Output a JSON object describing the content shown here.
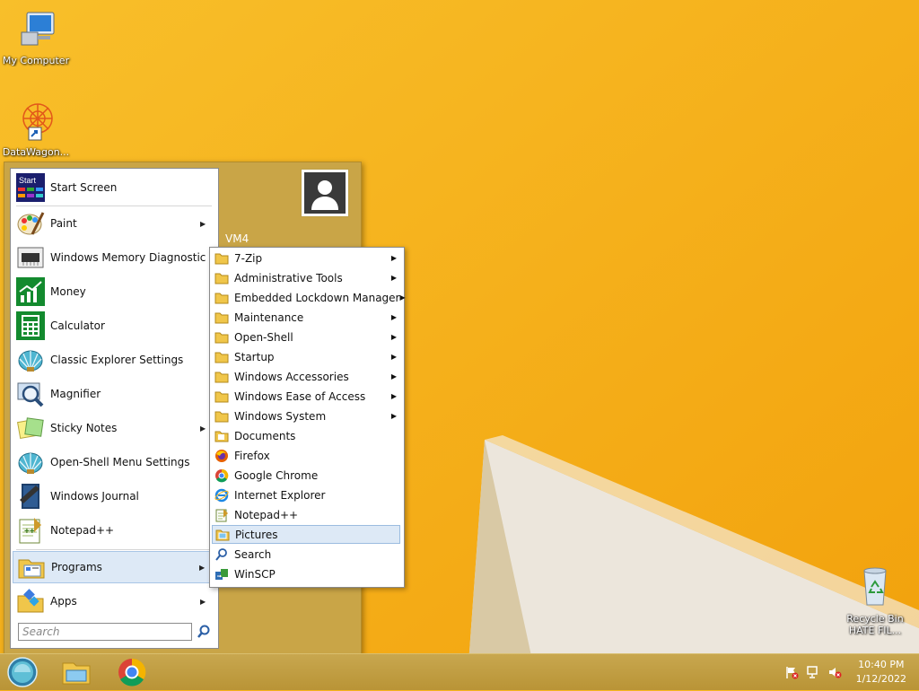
{
  "desktop": {
    "icons": [
      {
        "label": "My Computer",
        "icon": "computer-icon"
      },
      {
        "label": "DataWagon...",
        "icon": "datawagon-shortcut-icon"
      },
      {
        "label": "Recycle Bin\nHATE FIL...",
        "line1": "Recycle Bin",
        "line2": "HATE FIL...",
        "icon": "recycle-bin-icon"
      }
    ]
  },
  "start_menu": {
    "user_name": "VM4",
    "items": [
      {
        "label": "Start Screen",
        "icon": "start-screen-icon",
        "has_submenu": false
      },
      {
        "label": "Paint",
        "icon": "paint-icon",
        "has_submenu": true
      },
      {
        "label": "Windows Memory Diagnostic",
        "icon": "memory-chip-icon",
        "has_submenu": false
      },
      {
        "label": "Money",
        "icon": "money-chart-icon",
        "has_submenu": false
      },
      {
        "label": "Calculator",
        "icon": "calculator-icon",
        "has_submenu": false
      },
      {
        "label": "Classic Explorer Settings",
        "icon": "shell-icon",
        "has_submenu": false
      },
      {
        "label": "Magnifier",
        "icon": "magnifier-icon",
        "has_submenu": false
      },
      {
        "label": "Sticky Notes",
        "icon": "sticky-notes-icon",
        "has_submenu": true
      },
      {
        "label": "Open-Shell Menu Settings",
        "icon": "shell-icon",
        "has_submenu": false
      },
      {
        "label": "Windows Journal",
        "icon": "journal-icon",
        "has_submenu": false
      },
      {
        "label": "Notepad++",
        "icon": "notepad-plus-icon",
        "has_submenu": false
      },
      {
        "label": "Programs",
        "icon": "programs-icon",
        "has_submenu": true,
        "selected": true
      },
      {
        "label": "Apps",
        "icon": "apps-icon",
        "has_submenu": true
      }
    ],
    "search_placeholder": "Search"
  },
  "programs_submenu": {
    "items": [
      {
        "label": "7-Zip",
        "icon": "folder-icon",
        "has_submenu": true
      },
      {
        "label": "Administrative Tools",
        "icon": "folder-icon",
        "has_submenu": true
      },
      {
        "label": "Embedded Lockdown Manager",
        "icon": "folder-icon",
        "has_submenu": true
      },
      {
        "label": "Maintenance",
        "icon": "folder-icon",
        "has_submenu": true
      },
      {
        "label": "Open-Shell",
        "icon": "folder-icon",
        "has_submenu": true
      },
      {
        "label": "Startup",
        "icon": "folder-icon",
        "has_submenu": true
      },
      {
        "label": "Windows Accessories",
        "icon": "folder-icon",
        "has_submenu": true
      },
      {
        "label": "Windows Ease of Access",
        "icon": "folder-icon",
        "has_submenu": true
      },
      {
        "label": "Windows System",
        "icon": "folder-icon",
        "has_submenu": true
      },
      {
        "label": "Documents",
        "icon": "documents-icon",
        "has_submenu": false
      },
      {
        "label": "Firefox",
        "icon": "firefox-icon",
        "has_submenu": false
      },
      {
        "label": "Google Chrome",
        "icon": "chrome-icon",
        "has_submenu": false
      },
      {
        "label": "Internet Explorer",
        "icon": "ie-icon",
        "has_submenu": false
      },
      {
        "label": "Notepad++",
        "icon": "notepad-plus-icon",
        "has_submenu": false
      },
      {
        "label": "Pictures",
        "icon": "pictures-icon",
        "has_submenu": false,
        "selected": true
      },
      {
        "label": "Search",
        "icon": "search-icon",
        "has_submenu": false
      },
      {
        "label": "WinSCP",
        "icon": "winscp-icon",
        "has_submenu": false
      }
    ]
  },
  "taskbar": {
    "buttons": [
      {
        "icon": "start-orb-icon"
      },
      {
        "icon": "file-explorer-icon"
      },
      {
        "icon": "chrome-icon"
      }
    ],
    "tray": {
      "icons": [
        "action-center-flag-icon",
        "network-icon",
        "volume-muted-icon"
      ],
      "time": "10:40 PM",
      "date": "1/12/2022"
    }
  },
  "colors": {
    "wallpaper": "#f5b11a",
    "menu_frame": "#c9a547",
    "selection": "#dde9f6"
  }
}
